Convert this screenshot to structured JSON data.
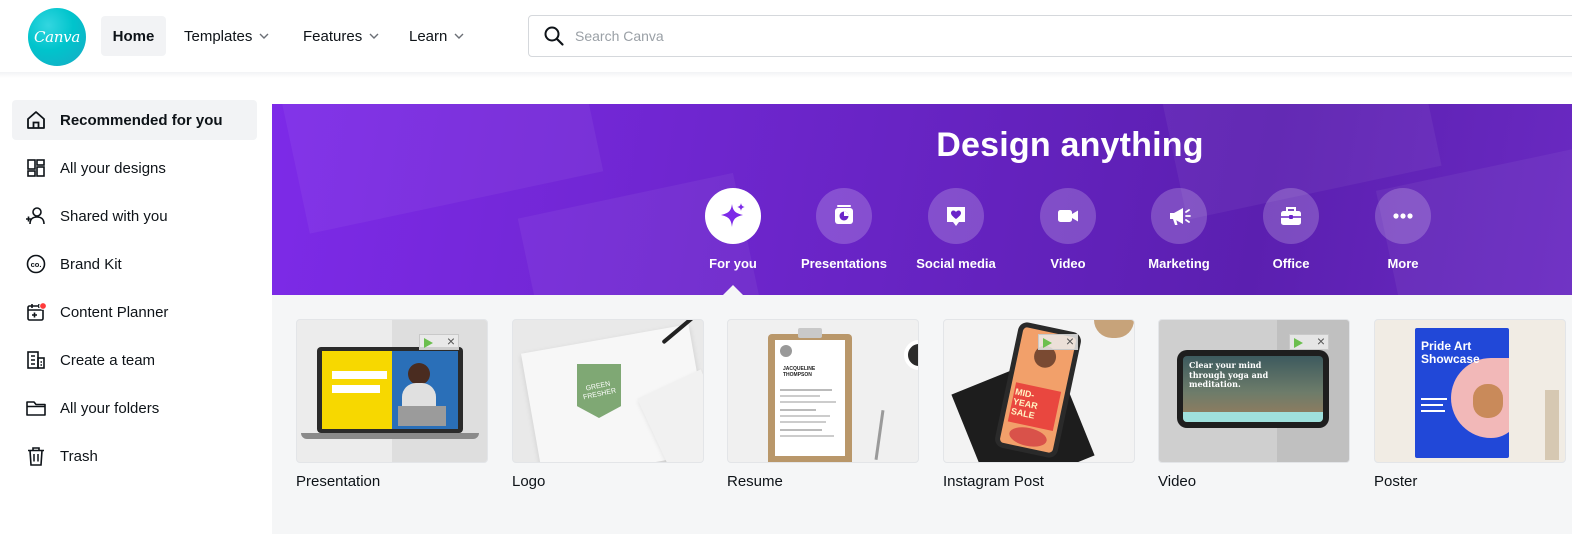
{
  "app": {
    "logo_text": "Canva",
    "brand_color": "#00c4cc",
    "accent_color": "#7d2ae8"
  },
  "nav": {
    "home": "Home",
    "items": [
      {
        "label": "Templates",
        "icon": "chevron-down-icon"
      },
      {
        "label": "Features",
        "icon": "chevron-down-icon"
      },
      {
        "label": "Learn",
        "icon": "chevron-down-icon"
      }
    ]
  },
  "search": {
    "placeholder": "Search Canva",
    "value": "",
    "icon": "search-icon"
  },
  "sidebar": {
    "items": [
      {
        "label": "Recommended for you",
        "icon": "home-icon",
        "active": true
      },
      {
        "label": "All your designs",
        "icon": "grid-icon"
      },
      {
        "label": "Shared with you",
        "icon": "shared-users-icon"
      },
      {
        "label": "Brand Kit",
        "icon": "brand-kit-icon"
      },
      {
        "label": "Content Planner",
        "icon": "calendar-icon",
        "badge_color": "#ff3b3b"
      },
      {
        "label": "Create a team",
        "icon": "building-icon"
      },
      {
        "label": "All your folders",
        "icon": "folder-icon"
      },
      {
        "label": "Trash",
        "icon": "trash-icon"
      }
    ]
  },
  "hero": {
    "title": "Design anything",
    "categories": [
      {
        "label": "For you",
        "icon": "sparkle-icon",
        "active": true
      },
      {
        "label": "Presentations",
        "icon": "presentation-icon"
      },
      {
        "label": "Social media",
        "icon": "heart-chat-icon"
      },
      {
        "label": "Video",
        "icon": "video-camera-icon"
      },
      {
        "label": "Marketing",
        "icon": "megaphone-icon"
      },
      {
        "label": "Office",
        "icon": "briefcase-icon"
      },
      {
        "label": "More",
        "icon": "more-dots-icon"
      }
    ]
  },
  "designs": [
    {
      "label": "Presentation",
      "thumb": {
        "overlay_text": ""
      }
    },
    {
      "label": "Logo",
      "thumb": {
        "badge_text": "GREEN FRESHER"
      }
    },
    {
      "label": "Resume",
      "thumb": {
        "name": "JACQUELINE THOMPSON"
      }
    },
    {
      "label": "Instagram Post",
      "thumb": {
        "promo_text": "MID-YEAR SALE"
      }
    },
    {
      "label": "Video",
      "thumb": {
        "overlay_text": "Clear your mind through yoga and meditation."
      }
    },
    {
      "label": "Poster",
      "thumb": {
        "title_text": "Pride Art Showcase"
      }
    }
  ]
}
